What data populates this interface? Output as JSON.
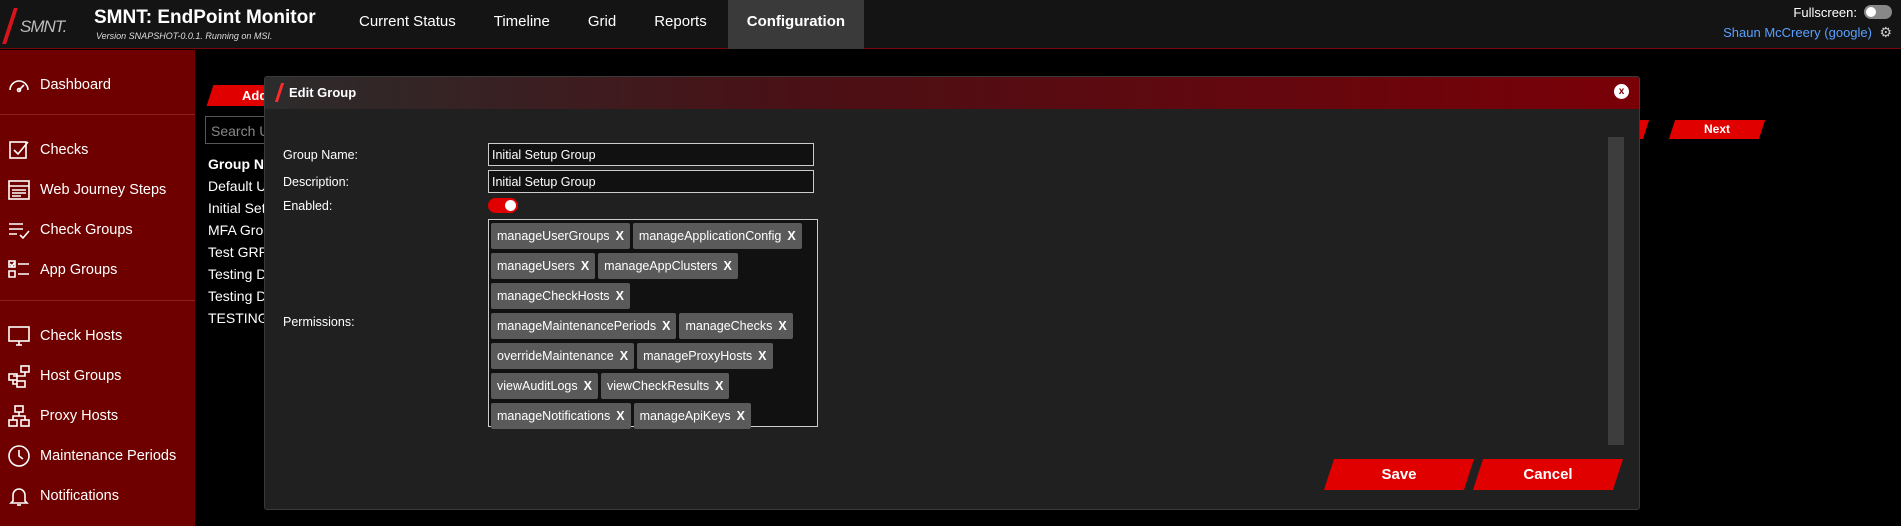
{
  "app": {
    "logo_text": "SMNT.",
    "title": "SMNT: EndPoint Monitor",
    "version": "Version SNAPSHOT-0.0.1. Running on MSI."
  },
  "nav": {
    "tabs": [
      "Current Status",
      "Timeline",
      "Grid",
      "Reports",
      "Configuration"
    ],
    "active": "Configuration"
  },
  "header": {
    "fullscreen_label": "Fullscreen:",
    "user": "Shaun McCreery (google)"
  },
  "sidebar": {
    "items": [
      {
        "label": "Dashboard",
        "icon": "dashboard-icon"
      },
      {
        "label": "Checks",
        "icon": "checkbox-icon"
      },
      {
        "label": "Web Journey Steps",
        "icon": "browser-icon"
      },
      {
        "label": "Check Groups",
        "icon": "list-check-icon"
      },
      {
        "label": "App Groups",
        "icon": "app-groups-icon"
      },
      {
        "label": "Check Hosts",
        "icon": "monitor-icon"
      },
      {
        "label": "Host Groups",
        "icon": "host-groups-icon"
      },
      {
        "label": "Proxy Hosts",
        "icon": "network-icon"
      },
      {
        "label": "Maintenance Periods",
        "icon": "clock-icon"
      },
      {
        "label": "Notifications",
        "icon": "bell-icon"
      }
    ]
  },
  "background": {
    "add_label": "Add",
    "search_placeholder": "Search U",
    "list_header": "Group Na",
    "list_items": [
      "Default U",
      "Initial Set",
      "MFA Grou",
      "Test GRRO",
      "Testing D",
      "Testing D",
      "TESTING"
    ],
    "prev_label": "s",
    "next_label": "Next"
  },
  "modal": {
    "title": "Edit Group",
    "close_label": "x",
    "group_name_label": "Group Name:",
    "group_name_value": "Initial Setup Group",
    "description_label": "Description:",
    "description_value": "Initial Setup Group",
    "enabled_label": "Enabled:",
    "enabled": true,
    "permissions_label": "Permissions:",
    "permissions": [
      "manageUserGroups",
      "manageApplicationConfig",
      "manageUsers",
      "manageAppClusters",
      "manageCheckHosts",
      "manageMaintenancePeriods",
      "manageChecks",
      "overrideMaintenance",
      "manageProxyHosts",
      "viewAuditLogs",
      "viewCheckResults",
      "manageNotifications",
      "manageApiKeys"
    ],
    "remove_label": "X",
    "save_label": "Save",
    "cancel_label": "Cancel"
  },
  "colors": {
    "accent": "#e00000",
    "sidebar": "#6e0000",
    "link": "#5aa0ff"
  }
}
